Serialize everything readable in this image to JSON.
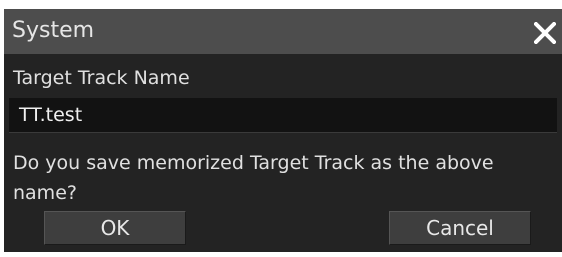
{
  "dialog": {
    "title": "System",
    "close_icon": "close-icon",
    "field_label": "Target Track Name",
    "field_value": "TT.test",
    "message": "Do you save memorized Target Track as the above name?",
    "ok_label": "OK",
    "cancel_label": "Cancel"
  },
  "colors": {
    "titlebar": "#4d4d4d",
    "background": "#232323",
    "field_background": "#121212",
    "button": "#3e3e3e",
    "text": "#e8e8e8"
  }
}
